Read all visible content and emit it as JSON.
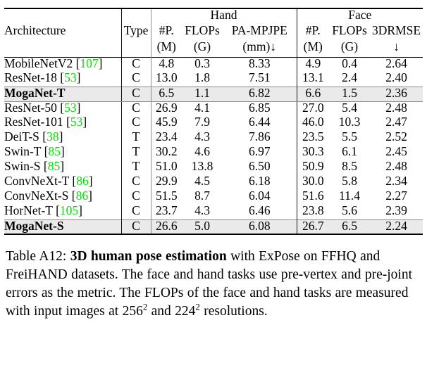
{
  "table": {
    "group_headers": [
      {
        "label": "Architecture",
        "span": 1
      },
      {
        "label": "Type",
        "span": 1
      },
      {
        "label": "Hand",
        "span": 3
      },
      {
        "label": "Face",
        "span": 3
      }
    ],
    "columns": [
      {
        "key": "arch",
        "line1": "Architecture",
        "line2": ""
      },
      {
        "key": "type",
        "line1": "Type",
        "line2": ""
      },
      {
        "key": "hand_p",
        "line1": "#P.",
        "line2": "(M)"
      },
      {
        "key": "hand_flops",
        "line1": "FLOPs",
        "line2": "(G)"
      },
      {
        "key": "hand_pa",
        "line1": "PA-MPJPE",
        "line2": "(mm)↓"
      },
      {
        "key": "face_p",
        "line1": "#P.",
        "line2": "(M)"
      },
      {
        "key": "face_flops",
        "line1": "FLOPs",
        "line2": "(G)"
      },
      {
        "key": "face_rmse",
        "line1": "3DRMSE",
        "line2": "↓"
      }
    ],
    "rows": [
      {
        "name": "MobileNetV2",
        "cite": "107",
        "type": "C",
        "hand_p": "4.8",
        "hand_flops": "0.3",
        "hand_pa": "8.33",
        "face_p": "4.9",
        "face_flops": "0.4",
        "face_rmse": "2.64",
        "highlight": false,
        "bold": false
      },
      {
        "name": "ResNet-18",
        "cite": "53",
        "type": "C",
        "hand_p": "13.0",
        "hand_flops": "1.8",
        "hand_pa": "7.51",
        "face_p": "13.1",
        "face_flops": "2.4",
        "face_rmse": "2.40",
        "highlight": false,
        "bold": false
      },
      {
        "name": "MogaNet-T",
        "cite": "",
        "type": "C",
        "hand_p": "6.5",
        "hand_flops": "1.1",
        "hand_pa": "6.82",
        "face_p": "6.6",
        "face_flops": "1.5",
        "face_rmse": "2.36",
        "highlight": true,
        "bold": true
      },
      {
        "name": "ResNet-50",
        "cite": "53",
        "type": "C",
        "hand_p": "26.9",
        "hand_flops": "4.1",
        "hand_pa": "6.85",
        "face_p": "27.0",
        "face_flops": "5.4",
        "face_rmse": "2.48",
        "highlight": false,
        "bold": false
      },
      {
        "name": "ResNet-101",
        "cite": "53",
        "type": "C",
        "hand_p": "45.9",
        "hand_flops": "7.9",
        "hand_pa": "6.44",
        "face_p": "46.0",
        "face_flops": "10.3",
        "face_rmse": "2.47",
        "highlight": false,
        "bold": false
      },
      {
        "name": "DeiT-S",
        "cite": "38",
        "type": "T",
        "hand_p": "23.4",
        "hand_flops": "4.3",
        "hand_pa": "7.86",
        "face_p": "23.5",
        "face_flops": "5.5",
        "face_rmse": "2.52",
        "highlight": false,
        "bold": false
      },
      {
        "name": "Swin-T",
        "cite": "85",
        "type": "T",
        "hand_p": "30.2",
        "hand_flops": "4.6",
        "hand_pa": "6.97",
        "face_p": "30.3",
        "face_flops": "6.1",
        "face_rmse": "2.45",
        "highlight": false,
        "bold": false
      },
      {
        "name": "Swin-S",
        "cite": "85",
        "type": "T",
        "hand_p": "51.0",
        "hand_flops": "13.8",
        "hand_pa": "6.50",
        "face_p": "50.9",
        "face_flops": "8.5",
        "face_rmse": "2.48",
        "highlight": false,
        "bold": false
      },
      {
        "name": "ConvNeXt-T",
        "cite": "86",
        "type": "C",
        "hand_p": "29.9",
        "hand_flops": "4.5",
        "hand_pa": "6.18",
        "face_p": "30.0",
        "face_flops": "5.8",
        "face_rmse": "2.34",
        "highlight": false,
        "bold": false
      },
      {
        "name": "ConvNeXt-S",
        "cite": "86",
        "type": "C",
        "hand_p": "51.5",
        "hand_flops": "8.7",
        "hand_pa": "6.04",
        "face_p": "51.6",
        "face_flops": "11.4",
        "face_rmse": "2.27",
        "highlight": false,
        "bold": false
      },
      {
        "name": "HorNet-T",
        "cite": "105",
        "type": "C",
        "hand_p": "23.7",
        "hand_flops": "4.3",
        "hand_pa": "6.46",
        "face_p": "23.8",
        "face_flops": "5.6",
        "face_rmse": "2.39",
        "highlight": false,
        "bold": false
      },
      {
        "name": "MogaNet-S",
        "cite": "",
        "type": "C",
        "hand_p": "26.6",
        "hand_flops": "5.0",
        "hand_pa": "6.08",
        "face_p": "26.7",
        "face_flops": "6.5",
        "face_rmse": "2.24",
        "highlight": true,
        "bold": true
      }
    ]
  },
  "caption": {
    "label": "Table A12:",
    "bold_title": "3D human pose estimation",
    "part1": " with ExPose on FFHQ and FreiHAND datasets. The face and hand tasks use pre-vertex and pre-joint errors as the metric. The FLOPs of the face and hand tasks are measured with input images at ",
    "res1": "256",
    "sup1": "2",
    "mid": " and ",
    "res2": "224",
    "sup2": "2",
    "part2": " resolutions."
  },
  "colors": {
    "citation_green": "#00e000",
    "highlight_row": "#eaeaea",
    "rule_dark": "#000000",
    "rule_light": "#8c8c8c"
  }
}
